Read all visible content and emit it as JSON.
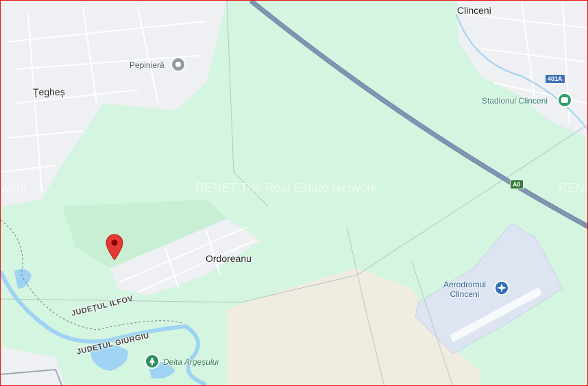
{
  "places": {
    "clinceni": "Clinceni",
    "teghes": "Ţegheș",
    "ordoreanu": "Ordoreanu"
  },
  "pois": {
    "pepiniera": "Pepinieră",
    "stadion": "Stadionul Clinceni",
    "aerodrom": "Aerodromul\nClinceni",
    "delta": "Delta Argeșului"
  },
  "counties": {
    "ilfov": "JUDEȚUL ILFOV",
    "giurgiu": "JUDEȚUL GIURGIU"
  },
  "roads": {
    "a0": "A0",
    "r401a": "401A"
  },
  "watermark": {
    "center": "RENET The Real Estate Network",
    "left": "work",
    "right": "RENE"
  },
  "colors": {
    "forest": "#d4f5df",
    "urban": "#eef0f3",
    "water": "#9fd3f4",
    "motorway": "#8296b4",
    "sand": "#f1ece0",
    "airfield": "#dde5f2",
    "pin": "#e53935"
  },
  "icons": {
    "pin": "location-pin-icon",
    "pepiniera": "poi-circle-icon",
    "stadion": "stadium-icon",
    "aerodrom": "airport-icon",
    "delta": "tree-icon"
  }
}
